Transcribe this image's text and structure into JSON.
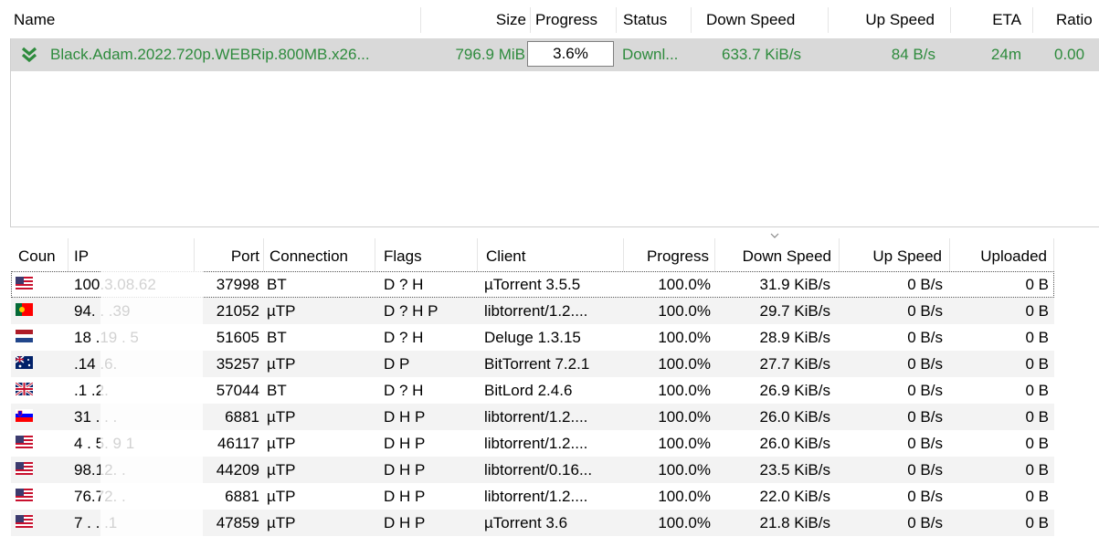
{
  "torrents": {
    "columns": {
      "name": "Name",
      "size": "Size",
      "progress": "Progress",
      "status": "Status",
      "down_speed": "Down Speed",
      "up_speed": "Up Speed",
      "eta": "ETA",
      "ratio": "Ratio"
    },
    "rows": [
      {
        "icon": "download-chevron-icon",
        "name": "Black.Adam.2022.720p.WEBRip.800MB.x26...",
        "size": "796.9 MiB",
        "progress": "3.6%",
        "status": "Downl...",
        "down_speed": "633.7 KiB/s",
        "up_speed": "84 B/s",
        "eta": "24m",
        "ratio": "0.00"
      }
    ]
  },
  "peers": {
    "columns": {
      "country": "Coun",
      "ip": "IP",
      "port": "Port",
      "connection": "Connection",
      "flags": "Flags",
      "client": "Client",
      "progress": "Progress",
      "down_speed": "Down Speed",
      "up_speed": "Up Speed",
      "uploaded": "Uploaded"
    },
    "rows": [
      {
        "flag": "us-flag-icon",
        "ip": "100.3.08.62",
        "port": "37998",
        "connection": "BT",
        "flags": "D ? H",
        "client": "µTorrent 3.5.5",
        "progress": "100.0%",
        "down_speed": "31.9 KiB/s",
        "up_speed": "0 B/s",
        "uploaded": "0 B"
      },
      {
        "flag": "portugal-flag-icon",
        "ip": "94.  .  .39",
        "port": "21052",
        "connection": "µTP",
        "flags": "D ? H P",
        "client": "libtorrent/1.2....",
        "progress": "100.0%",
        "down_speed": "29.7 KiB/s",
        "up_speed": "0 B/s",
        "uploaded": "0 B"
      },
      {
        "flag": "netherlands-flag-icon",
        "ip": "18  .19 .  5",
        "port": "51605",
        "connection": "BT",
        "flags": "D ? H",
        "client": "Deluge 1.3.15",
        "progress": "100.0%",
        "down_speed": "28.9 KiB/s",
        "up_speed": "0 B/s",
        "uploaded": "0 B"
      },
      {
        "flag": "australia-flag-icon",
        "ip": "  .14 .6.",
        "port": "35257",
        "connection": "µTP",
        "flags": "D P",
        "client": "BitTorrent 7.2.1",
        "progress": "100.0%",
        "down_speed": "27.7 KiB/s",
        "up_speed": "0 B/s",
        "uploaded": "0 B"
      },
      {
        "flag": "uk-flag-icon",
        "ip": "  .1 .2.",
        "port": "57044",
        "connection": "BT",
        "flags": "D ? H",
        "client": "BitLord 2.4.6",
        "progress": "100.0%",
        "down_speed": "26.9 KiB/s",
        "up_speed": "0 B/s",
        "uploaded": "0 B"
      },
      {
        "flag": "slovenia-flag-icon",
        "ip": "31  .  .  .",
        "port": "6881",
        "connection": "µTP",
        "flags": "D H P",
        "client": "libtorrent/1.2....",
        "progress": "100.0%",
        "down_speed": "26.0 KiB/s",
        "up_speed": "0 B/s",
        "uploaded": "0 B"
      },
      {
        "flag": "us-flag-icon",
        "ip": "  4 . 5. 9 1",
        "port": "46117",
        "connection": "µTP",
        "flags": "D H P",
        "client": "libtorrent/1.2....",
        "progress": "100.0%",
        "down_speed": "26.0 KiB/s",
        "up_speed": "0 B/s",
        "uploaded": "0 B"
      },
      {
        "flag": "us-flag-icon",
        "ip": "98.12.  .  ",
        "port": "44209",
        "connection": "µTP",
        "flags": "D H P",
        "client": "libtorrent/0.16...",
        "progress": "100.0%",
        "down_speed": "23.5 KiB/s",
        "up_speed": "0 B/s",
        "uploaded": "0 B"
      },
      {
        "flag": "us-flag-icon",
        "ip": "76.72.  .  ",
        "port": "6881",
        "connection": "µTP",
        "flags": "D H P",
        "client": "libtorrent/1.2....",
        "progress": "100.0%",
        "down_speed": "22.0 KiB/s",
        "up_speed": "0 B/s",
        "uploaded": "0 B"
      },
      {
        "flag": "us-flag-icon",
        "ip": "7  .  .  .1",
        "port": "47859",
        "connection": "µTP",
        "flags": "D H P",
        "client": "µTorrent 3.6",
        "progress": "100.0%",
        "down_speed": "21.8 KiB/s",
        "up_speed": "0 B/s",
        "uploaded": "0 B"
      }
    ]
  },
  "colors": {
    "downloading_text": "#2e8b3d",
    "selected_row": "#d9d9d9",
    "alt_row": "#f3f3f3"
  }
}
